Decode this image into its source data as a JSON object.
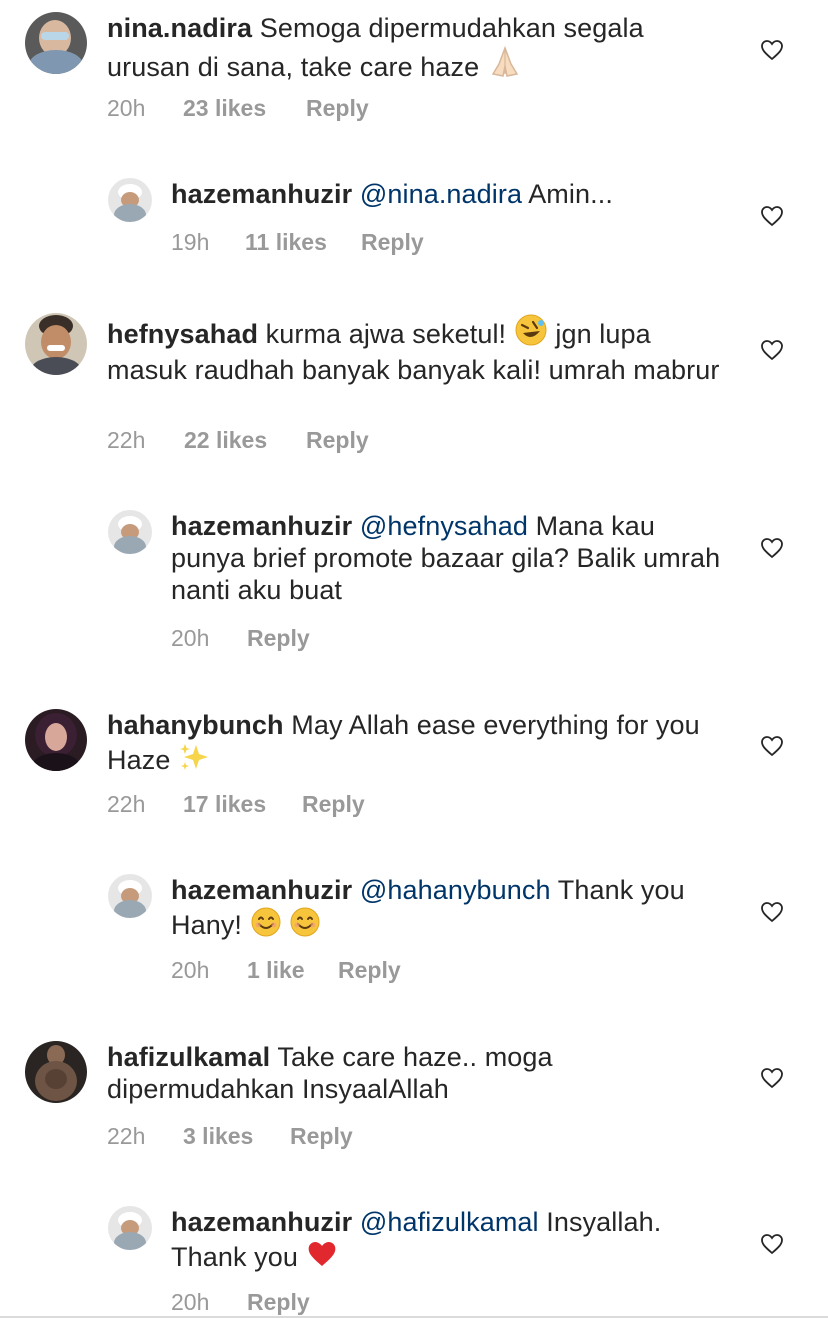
{
  "comments": [
    {
      "username": "nina.nadira",
      "text": "Semoga dipermudahkan segala urusan di sana, take care haze",
      "emoji": "folded-hands",
      "time": "20h",
      "likes": "23 likes",
      "reply_label": "Reply",
      "replies": [
        {
          "username": "hazemanhuzir",
          "mention": "@nina.nadira",
          "text": "Amin...",
          "time": "19h",
          "likes": "11 likes",
          "reply_label": "Reply"
        }
      ]
    },
    {
      "username": "hefnysahad",
      "text_before": "kurma ajwa seketul!",
      "emoji": "rolling-laughing",
      "text_after": "jgn lupa masuk raudhah banyak banyak kali! umrah mabrur",
      "time": "22h",
      "likes": "22 likes",
      "reply_label": "Reply",
      "replies": [
        {
          "username": "hazemanhuzir",
          "mention": "@hefnysahad",
          "text": "Mana kau punya brief promote bazaar gila? Balik umrah nanti aku buat",
          "time": "20h",
          "likes": "",
          "reply_label": "Reply"
        }
      ]
    },
    {
      "username": "hahanybunch",
      "text": "May Allah ease everything for you Haze",
      "emoji": "sparkles",
      "time": "22h",
      "likes": "17 likes",
      "reply_label": "Reply",
      "replies": [
        {
          "username": "hazemanhuzir",
          "mention": "@hahanybunch",
          "text": "Thank you Hany!",
          "emoji": "smiling-face x2",
          "time": "20h",
          "likes": "1 like",
          "reply_label": "Reply"
        }
      ]
    },
    {
      "username": "hafizulkamal",
      "text": "Take care haze.. moga dipermudahkan InsyaalAllah",
      "time": "22h",
      "likes": "3 likes",
      "reply_label": "Reply",
      "replies": [
        {
          "username": "hazemanhuzir",
          "mention": "@hafizulkamal",
          "text": "Insyallah. Thank you",
          "emoji": "red-heart",
          "time": "20h",
          "likes": "",
          "reply_label": "Reply"
        }
      ]
    }
  ],
  "icons": {
    "like": "heart-outline-icon"
  },
  "colors": {
    "text": "#262626",
    "meta": "#999999",
    "mention": "#003569"
  }
}
